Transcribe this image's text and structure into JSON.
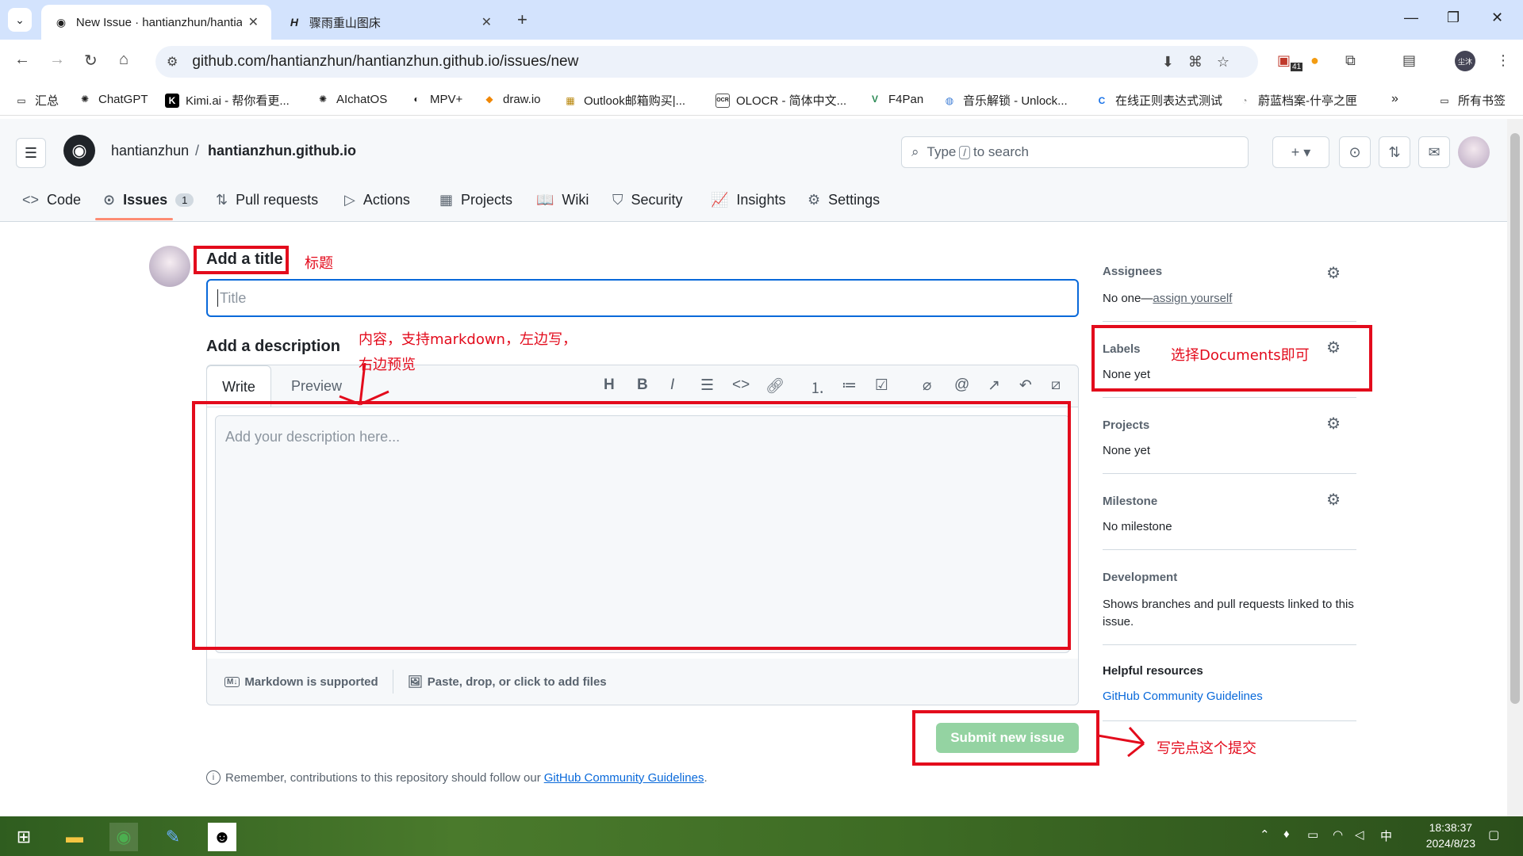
{
  "browser": {
    "tabs": [
      {
        "title": "New Issue · hantianzhun/hantianzhun.github.io",
        "icon": "github-icon"
      },
      {
        "title": "骤雨重山图床",
        "icon": "h-icon"
      }
    ],
    "url": "github.com/hantianzhun/hantianzhun.github.io/issues/new",
    "extension_badge": "41",
    "profile_label": "尘沐"
  },
  "bookmarks": [
    "汇总",
    "ChatGPT",
    "Kimi.ai - 帮你看更...",
    "AIchatOS",
    "MPV+",
    "draw.io",
    "Outlook邮箱购买|...",
    "OLOCR - 简体中文...",
    "F4Pan",
    "音乐解锁 - Unlock...",
    "在线正则表达式测试",
    "蔚蓝档案-什亭之匣",
    "所有书签"
  ],
  "header": {
    "owner": "hantianzhun",
    "separator": "/",
    "repo": "hantianzhun.github.io",
    "search_before": "Type",
    "search_key": "/",
    "search_after": "to search"
  },
  "repo_tabs": [
    {
      "label": "Code",
      "icon": "<>"
    },
    {
      "label": "Issues",
      "icon": "⊙",
      "count": "1"
    },
    {
      "label": "Pull requests",
      "icon": "⇅"
    },
    {
      "label": "Actions",
      "icon": "▷"
    },
    {
      "label": "Projects",
      "icon": "▦"
    },
    {
      "label": "Wiki",
      "icon": "📖"
    },
    {
      "label": "Security",
      "icon": "⛉"
    },
    {
      "label": "Insights",
      "icon": "📈"
    },
    {
      "label": "Settings",
      "icon": "⚙"
    }
  ],
  "form": {
    "title_heading": "Add a title",
    "title_placeholder": "Title",
    "desc_heading": "Add a description",
    "tab_write": "Write",
    "tab_preview": "Preview",
    "desc_placeholder": "Add your description here...",
    "markdown_note": "Markdown is supported",
    "attach_note": "Paste, drop, or click to add files",
    "submit_label": "Submit new issue",
    "remember_text": "Remember, contributions to this repository should follow our",
    "remember_link": "GitHub Community Guidelines",
    "remember_end": "."
  },
  "sidebar": {
    "assignees_h": "Assignees",
    "assignees_v": "No one—",
    "assignees_link": "assign yourself",
    "labels_h": "Labels",
    "labels_v": "None yet",
    "projects_h": "Projects",
    "projects_v": "None yet",
    "milestone_h": "Milestone",
    "milestone_v": "No milestone",
    "development_h": "Development",
    "development_v": "Shows branches and pull requests linked to this issue.",
    "helpful_h": "Helpful resources",
    "helpful_link": "GitHub Community Guidelines"
  },
  "annotations": {
    "title_note": "标题",
    "desc_note_1": "内容，支持markdown，左边写，",
    "desc_note_2": "右边预览",
    "labels_note": "选择Documents即可",
    "submit_note": "写完点这个提交"
  },
  "taskbar": {
    "time": "18:38:37",
    "date": "2024/8/23",
    "ime": "中"
  },
  "colors": {
    "accent": "#0969da",
    "annotation_red": "#e30b1c",
    "submit_disabled": "#94d3a2",
    "tab_underline": "#fd8c73"
  }
}
